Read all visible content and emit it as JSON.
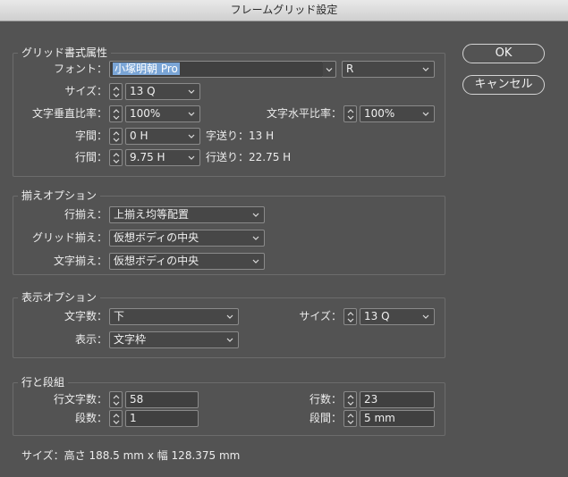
{
  "window": {
    "title": "フレームグリッド設定"
  },
  "buttons": {
    "ok": "OK",
    "cancel": "キャンセル"
  },
  "grid_attrs": {
    "legend": "グリッド書式属性",
    "font_label": "フォント：",
    "font_value": "小塚明朝 Pro",
    "style_value": "R",
    "size_label": "サイズ：",
    "size_value": "13 Q",
    "vscale_label": "文字垂直比率：",
    "vscale_value": "100%",
    "hscale_label": "文字水平比率：",
    "hscale_value": "100%",
    "char_aki_label": "字間：",
    "char_aki_value": "0 H",
    "char_pitch_text": "字送り：13 H",
    "line_aki_label": "行間：",
    "line_aki_value": "9.75 H",
    "line_pitch_text": "行送り：22.75 H"
  },
  "alignment": {
    "legend": "揃えオプション",
    "line_align_label": "行揃え：",
    "line_align_value": "上揃え均等配置",
    "grid_align_label": "グリッド揃え：",
    "grid_align_value": "仮想ボディの中央",
    "char_align_label": "文字揃え：",
    "char_align_value": "仮想ボディの中央"
  },
  "view": {
    "legend": "表示オプション",
    "count_label": "文字数：",
    "count_value": "下",
    "size_label": "サイズ：",
    "size_value": "13 Q",
    "display_label": "表示：",
    "display_value": "文字枠"
  },
  "lines_columns": {
    "legend": "行と段組",
    "chars_label": "行文字数：",
    "chars_value": "58",
    "lines_label": "行数：",
    "lines_value": "23",
    "cols_label": "段数：",
    "cols_value": "1",
    "gutter_label": "段間：",
    "gutter_value": "5 mm"
  },
  "footer": {
    "size_text": "サイズ：高さ 188.5 mm x 幅 128.375 mm"
  },
  "colors": {
    "panel": "#535353",
    "selection": "#7aa5d6"
  }
}
